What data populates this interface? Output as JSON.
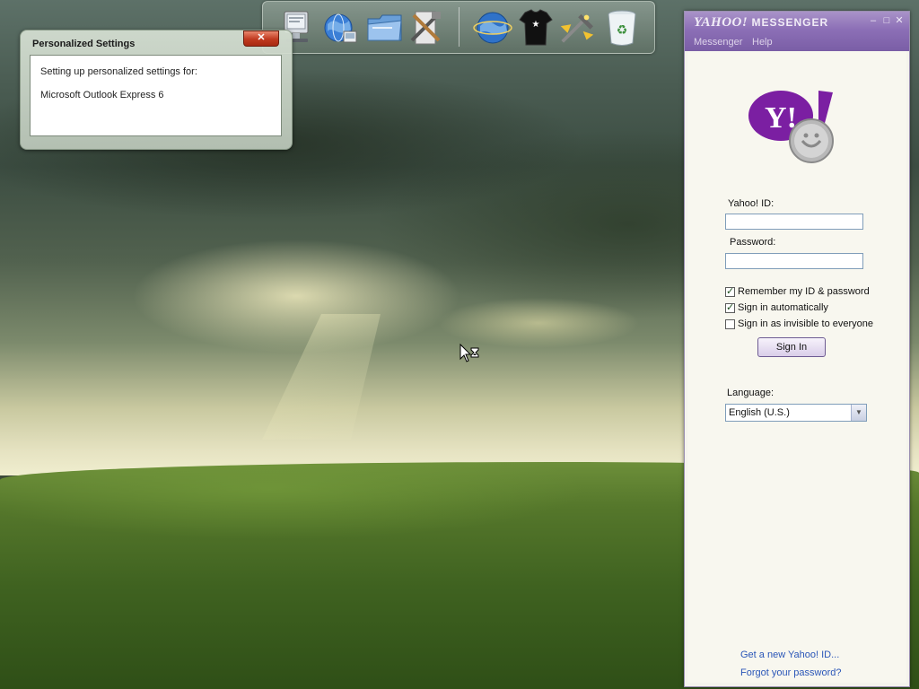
{
  "dock": {
    "icons": [
      {
        "name": "computer-icon"
      },
      {
        "name": "network-globe-icon"
      },
      {
        "name": "folder-icon"
      },
      {
        "name": "tools-icon"
      },
      {
        "name": "internet-globe-icon"
      },
      {
        "name": "tshirt-icon"
      },
      {
        "name": "wizard-icon"
      },
      {
        "name": "recycle-bin-icon"
      }
    ]
  },
  "popup": {
    "title": "Personalized Settings",
    "close_label": "✕",
    "line1": "Setting up personalized settings for:",
    "line2": "Microsoft Outlook Express 6"
  },
  "messenger": {
    "title_brand": "YAHOO!",
    "title_product": "MESSENGER",
    "menu": [
      "Messenger",
      "Help"
    ],
    "logo_text": "Y!",
    "yahoo_id_label": "Yahoo! ID:",
    "yahoo_id_value": "",
    "password_label": "Password:",
    "password_value": "",
    "checkboxes": [
      {
        "label": "Remember my ID & password",
        "checked": true
      },
      {
        "label": "Sign in automatically",
        "checked": true
      },
      {
        "label": "Sign in as invisible to everyone",
        "checked": false
      }
    ],
    "signin_label": "Sign In",
    "language_label": "Language:",
    "language_value": "English (U.S.)",
    "links": [
      "Get a new Yahoo! ID...",
      "Forgot your password?"
    ]
  },
  "colors": {
    "messenger_purple": "#7b5ea7",
    "link_blue": "#2a56b8",
    "close_red": "#c0391f"
  }
}
